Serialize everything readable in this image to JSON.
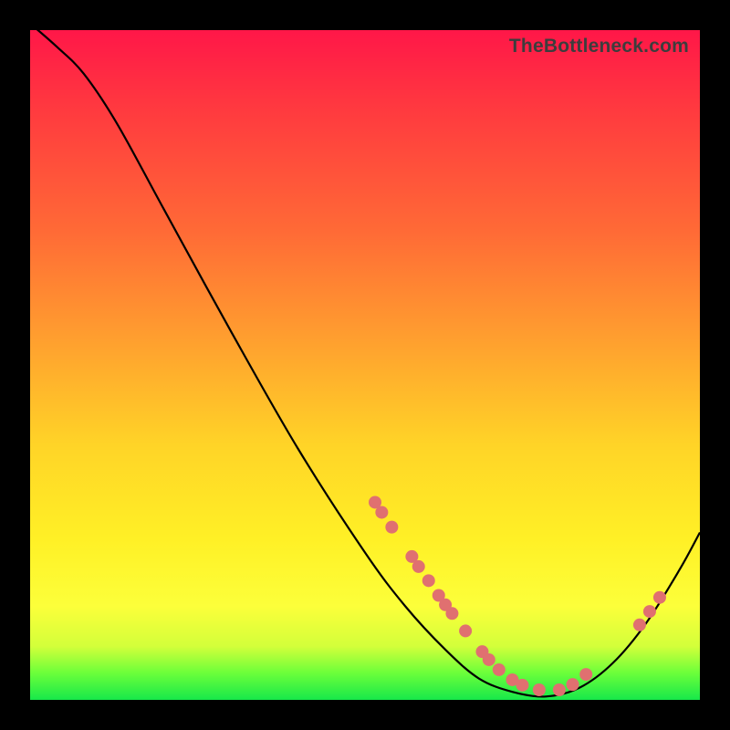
{
  "watermark": "TheBottleneck.com",
  "colors": {
    "background": "#000000",
    "gradient_top": "#ff1748",
    "gradient_bottom": "#17e84a",
    "curve": "#000000",
    "marker_fill": "#e07070",
    "marker_stroke": "#c95a5a"
  },
  "chart_data": {
    "type": "line",
    "title": "",
    "xlabel": "",
    "ylabel": "",
    "xlim": [
      0,
      100
    ],
    "ylim": [
      0,
      100
    ],
    "grid": false,
    "legend": false,
    "note": "Axes are unlabeled in the image; values below are estimated in percent-of-plot coordinates (x right, y up).",
    "curve_xy": [
      [
        0,
        101
      ],
      [
        4,
        97.5
      ],
      [
        8,
        93.5
      ],
      [
        13,
        86
      ],
      [
        20,
        73.2
      ],
      [
        30,
        55
      ],
      [
        40,
        37.5
      ],
      [
        50,
        22
      ],
      [
        56,
        14
      ],
      [
        62,
        7.5
      ],
      [
        67,
        3.2
      ],
      [
        72,
        1.2
      ],
      [
        77,
        0.5
      ],
      [
        82,
        1.8
      ],
      [
        87,
        5.5
      ],
      [
        92,
        11.5
      ],
      [
        97,
        19.5
      ],
      [
        100,
        25
      ]
    ],
    "series": [
      {
        "name": "markers",
        "color": "#e07070",
        "xy": [
          [
            51.5,
            29.5
          ],
          [
            52.5,
            28.0
          ],
          [
            54.0,
            25.8
          ],
          [
            57.0,
            21.4
          ],
          [
            58.0,
            19.9
          ],
          [
            59.5,
            17.8
          ],
          [
            61.0,
            15.6
          ],
          [
            62.0,
            14.2
          ],
          [
            63.0,
            12.9
          ],
          [
            65.0,
            10.3
          ],
          [
            67.5,
            7.2
          ],
          [
            68.5,
            6.0
          ],
          [
            70.0,
            4.5
          ],
          [
            72.0,
            3.0
          ],
          [
            73.5,
            2.2
          ],
          [
            76.0,
            1.5
          ],
          [
            79.0,
            1.5
          ],
          [
            81.0,
            2.3
          ],
          [
            83.0,
            3.8
          ],
          [
            91.0,
            11.2
          ],
          [
            92.5,
            13.2
          ],
          [
            94.0,
            15.3
          ]
        ]
      }
    ]
  }
}
